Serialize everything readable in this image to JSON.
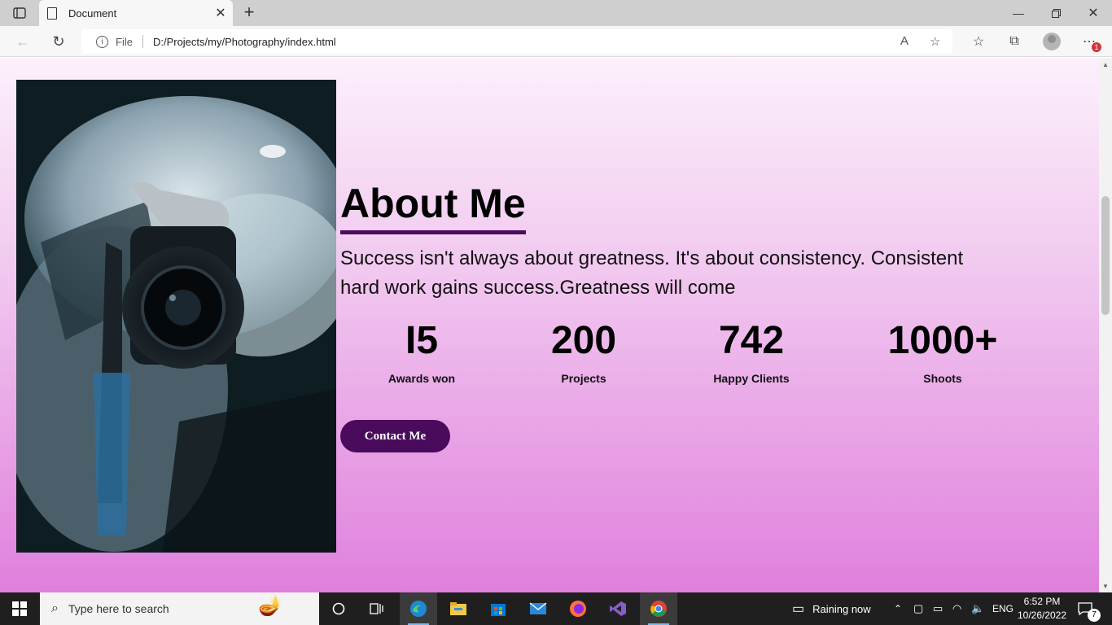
{
  "browser": {
    "tab_title": "Document",
    "address_prefix": "File",
    "url": "D:/Projects/my/Photography/index.html",
    "notification_count": "1"
  },
  "about": {
    "heading": "About Me",
    "text": "Success isn't always about greatness. It's about consistency. Consistent hard work gains success.Greatness will come",
    "stats": [
      {
        "value": "I5",
        "label": "Awards won"
      },
      {
        "value": "200",
        "label": "Projects"
      },
      {
        "value": "742",
        "label": "Happy Clients"
      },
      {
        "value": "1000+",
        "label": "Shoots"
      }
    ],
    "button_label": "Contact Me",
    "accent_color": "#4a0b5c"
  },
  "taskbar": {
    "search_placeholder": "Type here to search",
    "weather": "Raining now",
    "language": "ENG",
    "time": "6:52 PM",
    "date": "10/26/2022",
    "notification_count": "7"
  }
}
